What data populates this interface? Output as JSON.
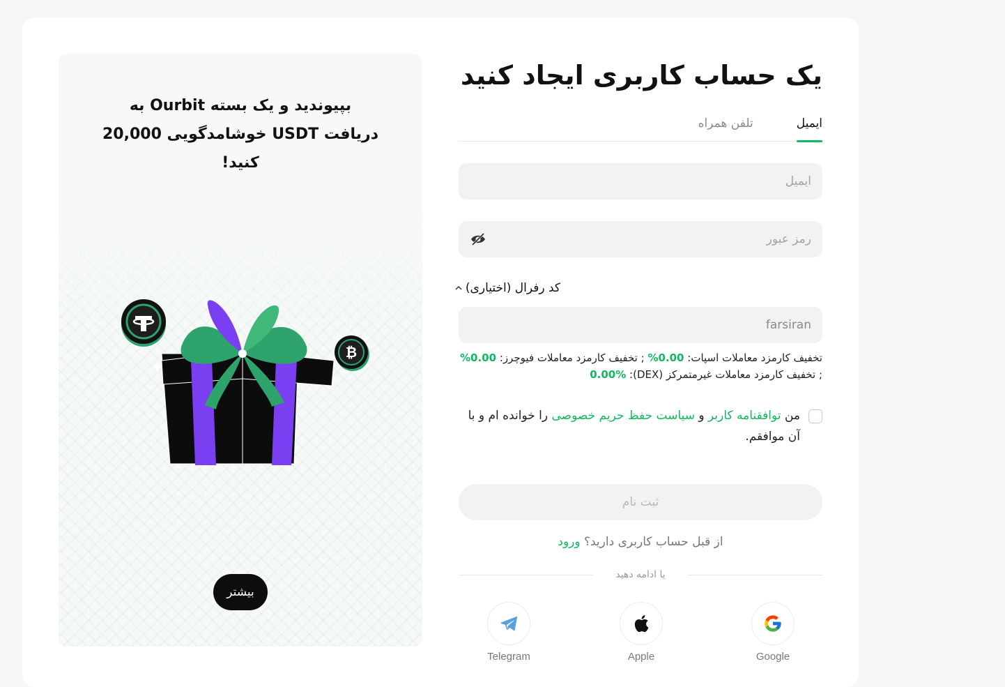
{
  "promo": {
    "title_line1": "بپیوندید و یک بسته Ourbit به",
    "title_line2": "دریافت USDT خوشامدگویی 20,000",
    "title_line3": "کنید!",
    "more_label": "بیشتر"
  },
  "form": {
    "title": "یک حساب کاربری ایجاد کنید",
    "tabs": [
      {
        "label": "ایمیل",
        "active": true
      },
      {
        "label": "تلفن همراه",
        "active": false
      }
    ],
    "email_placeholder": "ایمیل",
    "password_placeholder": "رمز عبور",
    "referral_label": "کد رفرال (اختیاری)",
    "referral_value": "farsiran",
    "discount": {
      "spot_label": "تخفیف کارمزد معاملات اسپات:",
      "spot_value": "0.00%",
      "sep": ";",
      "futures_label": "تخفیف کارمزد معاملات فیوچرز:",
      "futures_value": "0.00%",
      "sep2": ";",
      "dex_label": "تخفیف کارمزد معاملات غیرمتمرکز (DEX):",
      "dex_value": "0.00%"
    },
    "agree": {
      "prefix": "من",
      "terms_link": "توافقنامه کاربر",
      "and": "و",
      "privacy_link": "سیاست حفظ حریم خصوصی",
      "suffix": "را خوانده ام و با آن موافقم."
    },
    "submit_label": "ثبت نام",
    "have_account": "از قبل حساب کاربری دارید؟",
    "login_link": "ورود",
    "divider_text": "یا ادامه دهید",
    "socials": [
      {
        "name": "Google",
        "icon": "google-icon"
      },
      {
        "name": "Apple",
        "icon": "apple-icon"
      },
      {
        "name": "Telegram",
        "icon": "telegram-icon"
      }
    ]
  },
  "colors": {
    "accent": "#10b95f",
    "gift_purple": "#7b3ff2",
    "gift_green": "#2ea36b"
  }
}
